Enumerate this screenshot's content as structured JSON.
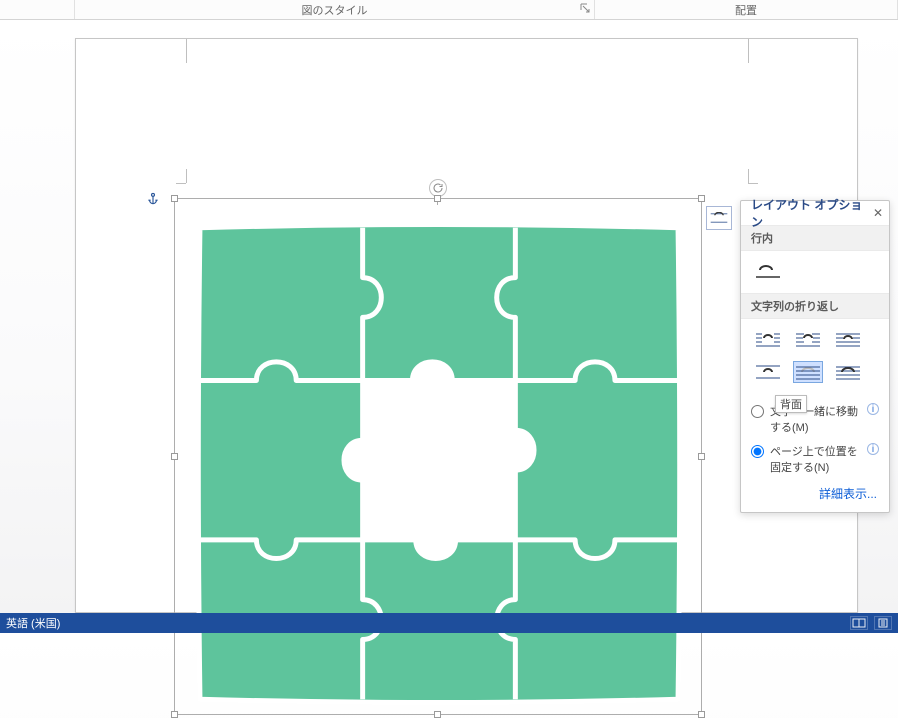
{
  "ribbon": {
    "group_style_label": "図のスタイル",
    "group_arrange_label": "配置"
  },
  "layout_options": {
    "title": "レイアウト オプション",
    "close": "✕",
    "inline_section": "行内",
    "wrap_section": "文字列の折り返し",
    "inline_icon": "inline",
    "wrap_icons": [
      "square",
      "tight",
      "through",
      "top-bottom",
      "behind",
      "front"
    ],
    "selected_wrap": "behind",
    "tooltip": "背面",
    "radio_move_label": "文字列と一緒に移動する(M)",
    "radio_move_label_visible_prefix": "文字",
    "radio_move_label_visible_suffix": "一緒に移動する(M)",
    "radio_fix_label": "ページ上で位置を固定する(N)",
    "radio_selected": "fix",
    "more_link": "詳細表示..."
  },
  "statusbar": {
    "language": "英語 (米国)"
  }
}
